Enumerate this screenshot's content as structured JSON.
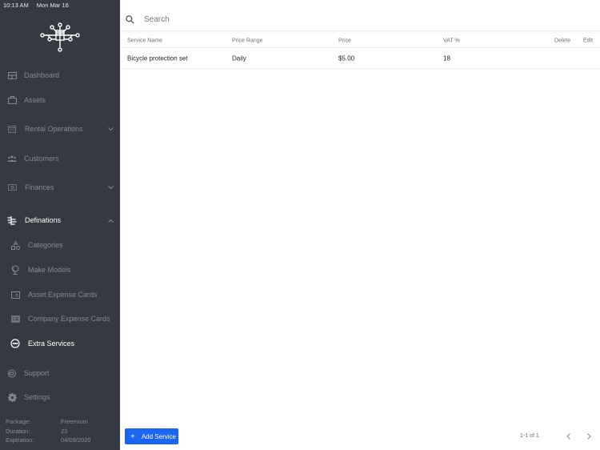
{
  "status_bar": {
    "time": "10:13 AM",
    "date": "Mon Mar 16"
  },
  "sidebar": {
    "logo": "circuit-tree-logo",
    "items": [
      {
        "label": "Dashboard",
        "icon": "dashboard-icon"
      },
      {
        "label": "Assets",
        "icon": "briefcase-icon"
      },
      {
        "label": "Rental Operations",
        "icon": "calendar-icon",
        "expandable": true,
        "expanded": false
      },
      {
        "label": "Customers",
        "icon": "people-icon"
      },
      {
        "label": "Finances",
        "icon": "money-icon",
        "expandable": true,
        "expanded": false
      },
      {
        "label": "Definations",
        "icon": "definitions-icon",
        "expandable": true,
        "expanded": true,
        "children": [
          {
            "label": "Categories",
            "icon": "shapes-icon"
          },
          {
            "label": "Make Models",
            "icon": "globe-stand-icon"
          },
          {
            "label": "Asset Expense Cards",
            "icon": "card-icon"
          },
          {
            "label": "Company Expense Cards",
            "icon": "card-list-icon"
          },
          {
            "label": "Extra Services",
            "icon": "more-circle-icon",
            "active": true
          }
        ]
      },
      {
        "label": "Support",
        "icon": "support-icon"
      },
      {
        "label": "Settings",
        "icon": "gear-icon"
      }
    ],
    "package": {
      "package_label": "Package:",
      "package_value": "Freemium",
      "duration_label": "Duration:",
      "duration_value": "23",
      "expiration_label": "Expiration:",
      "expiration_value": "04/09/2020"
    }
  },
  "main": {
    "search": {
      "placeholder": "Search",
      "value": ""
    },
    "table": {
      "columns": [
        "Service Name",
        "Price Range",
        "Price",
        "VAT %",
        "Delete",
        "Edit"
      ],
      "rows": [
        {
          "service_name": "Bicycle protection set",
          "price_range": "Daily",
          "price": "$5.00",
          "vat": "18"
        }
      ]
    },
    "add_button": {
      "icon": "+",
      "label": "Add Service"
    },
    "pagination": {
      "text": "1-1 of 1"
    }
  },
  "colors": {
    "sidebar_bg": "#353a42",
    "accent": "#1a66f0"
  }
}
